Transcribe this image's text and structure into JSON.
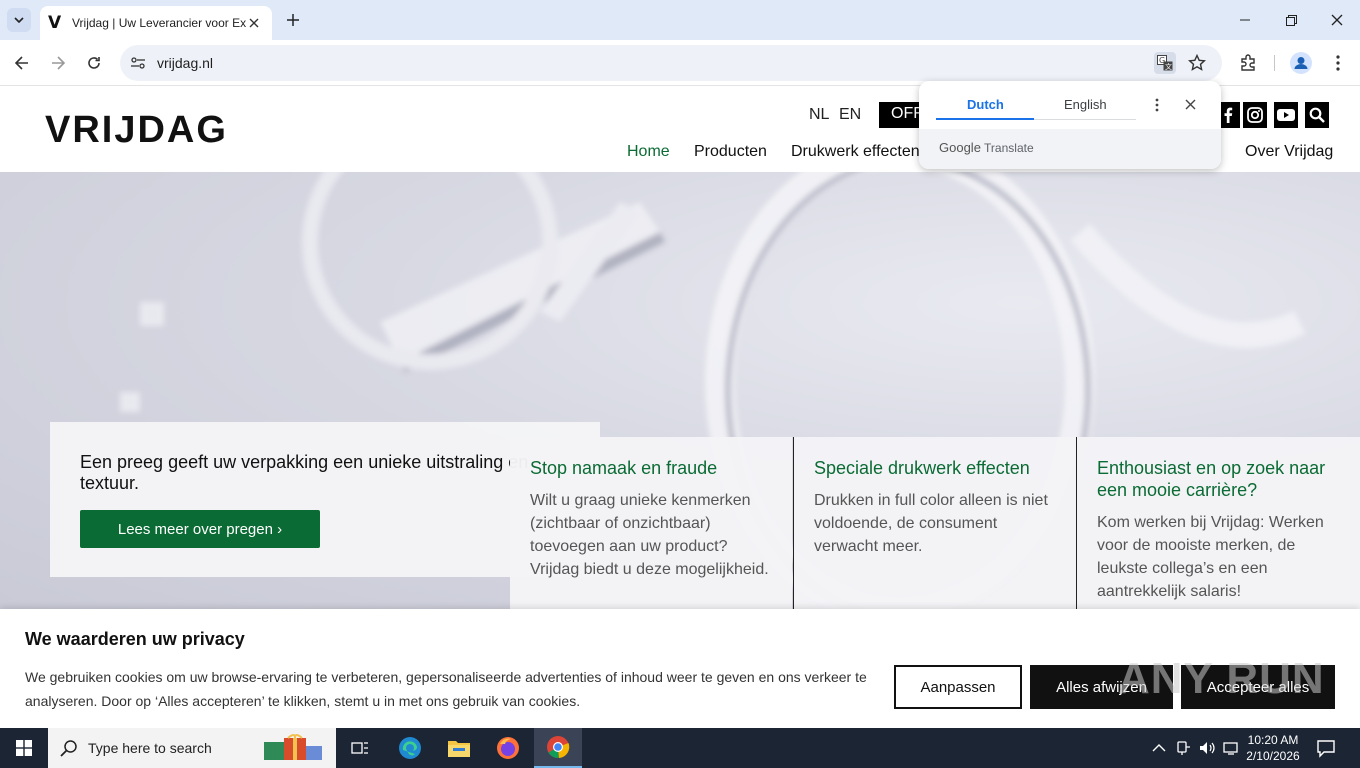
{
  "browser": {
    "tab_title": "Vrijdag | Uw Leverancier voor Exclusief Drukwerk",
    "tab_favicon": "V",
    "url": "vrijdag.nl"
  },
  "translate_popup": {
    "tab_source": "Dutch",
    "tab_target": "English",
    "footer": "Google Translate",
    "footer_brand": "Google",
    "footer_suffix": "Translate"
  },
  "site": {
    "logo": "VRIJDAG",
    "lang_nl": "NL",
    "lang_en": "EN",
    "offerte_label": "OFFERTE",
    "nav": {
      "home": "Home",
      "producten": "Producten",
      "drukwerk": "Drukwerk effecten",
      "over": "Over Vrijdag"
    }
  },
  "hero": {
    "text": "Een preeg geeft uw verpakking een unieke uitstraling en textuur.",
    "cta": "Lees meer over pregen ›"
  },
  "cards": [
    {
      "title": "Stop namaak en fraude",
      "text": "Wilt u graag unieke kenmerken (zichtbaar of onzichtbaar) toevoegen aan uw product? Vrijdag biedt u deze mogelijkheid."
    },
    {
      "title": "Speciale drukwerk effecten",
      "text": "Drukken in full color alleen is niet voldoende, de consument verwacht meer."
    },
    {
      "title": "Enthousiast en op zoek naar een mooie carrière?",
      "text": "Kom werken bij Vrijdag: Werken voor de mooiste merken, de leukste collega’s en een aantrekkelijk salaris!"
    }
  ],
  "cookie": {
    "title": "We waarderen uw privacy",
    "text": "We gebruiken cookies om uw browse-ervaring te verbeteren, gepersonaliseerde advertenties of inhoud weer te geven en ons verkeer te analyseren. Door op ‘Alles accepteren’ te klikken, stemt u in met ons gebruik van cookies.",
    "btn_customize": "Aanpassen",
    "btn_reject": "Alles afwijzen",
    "btn_accept": "Accepteer alles"
  },
  "watermark": "ANY RUN",
  "taskbar": {
    "search_placeholder": "Type here to search",
    "time": "10:20 AM",
    "date": "2/10/2026"
  },
  "colors": {
    "brand_green": "#0b6b34",
    "tab_strip": "#dfe9f8",
    "taskbar": "#1c2533"
  }
}
